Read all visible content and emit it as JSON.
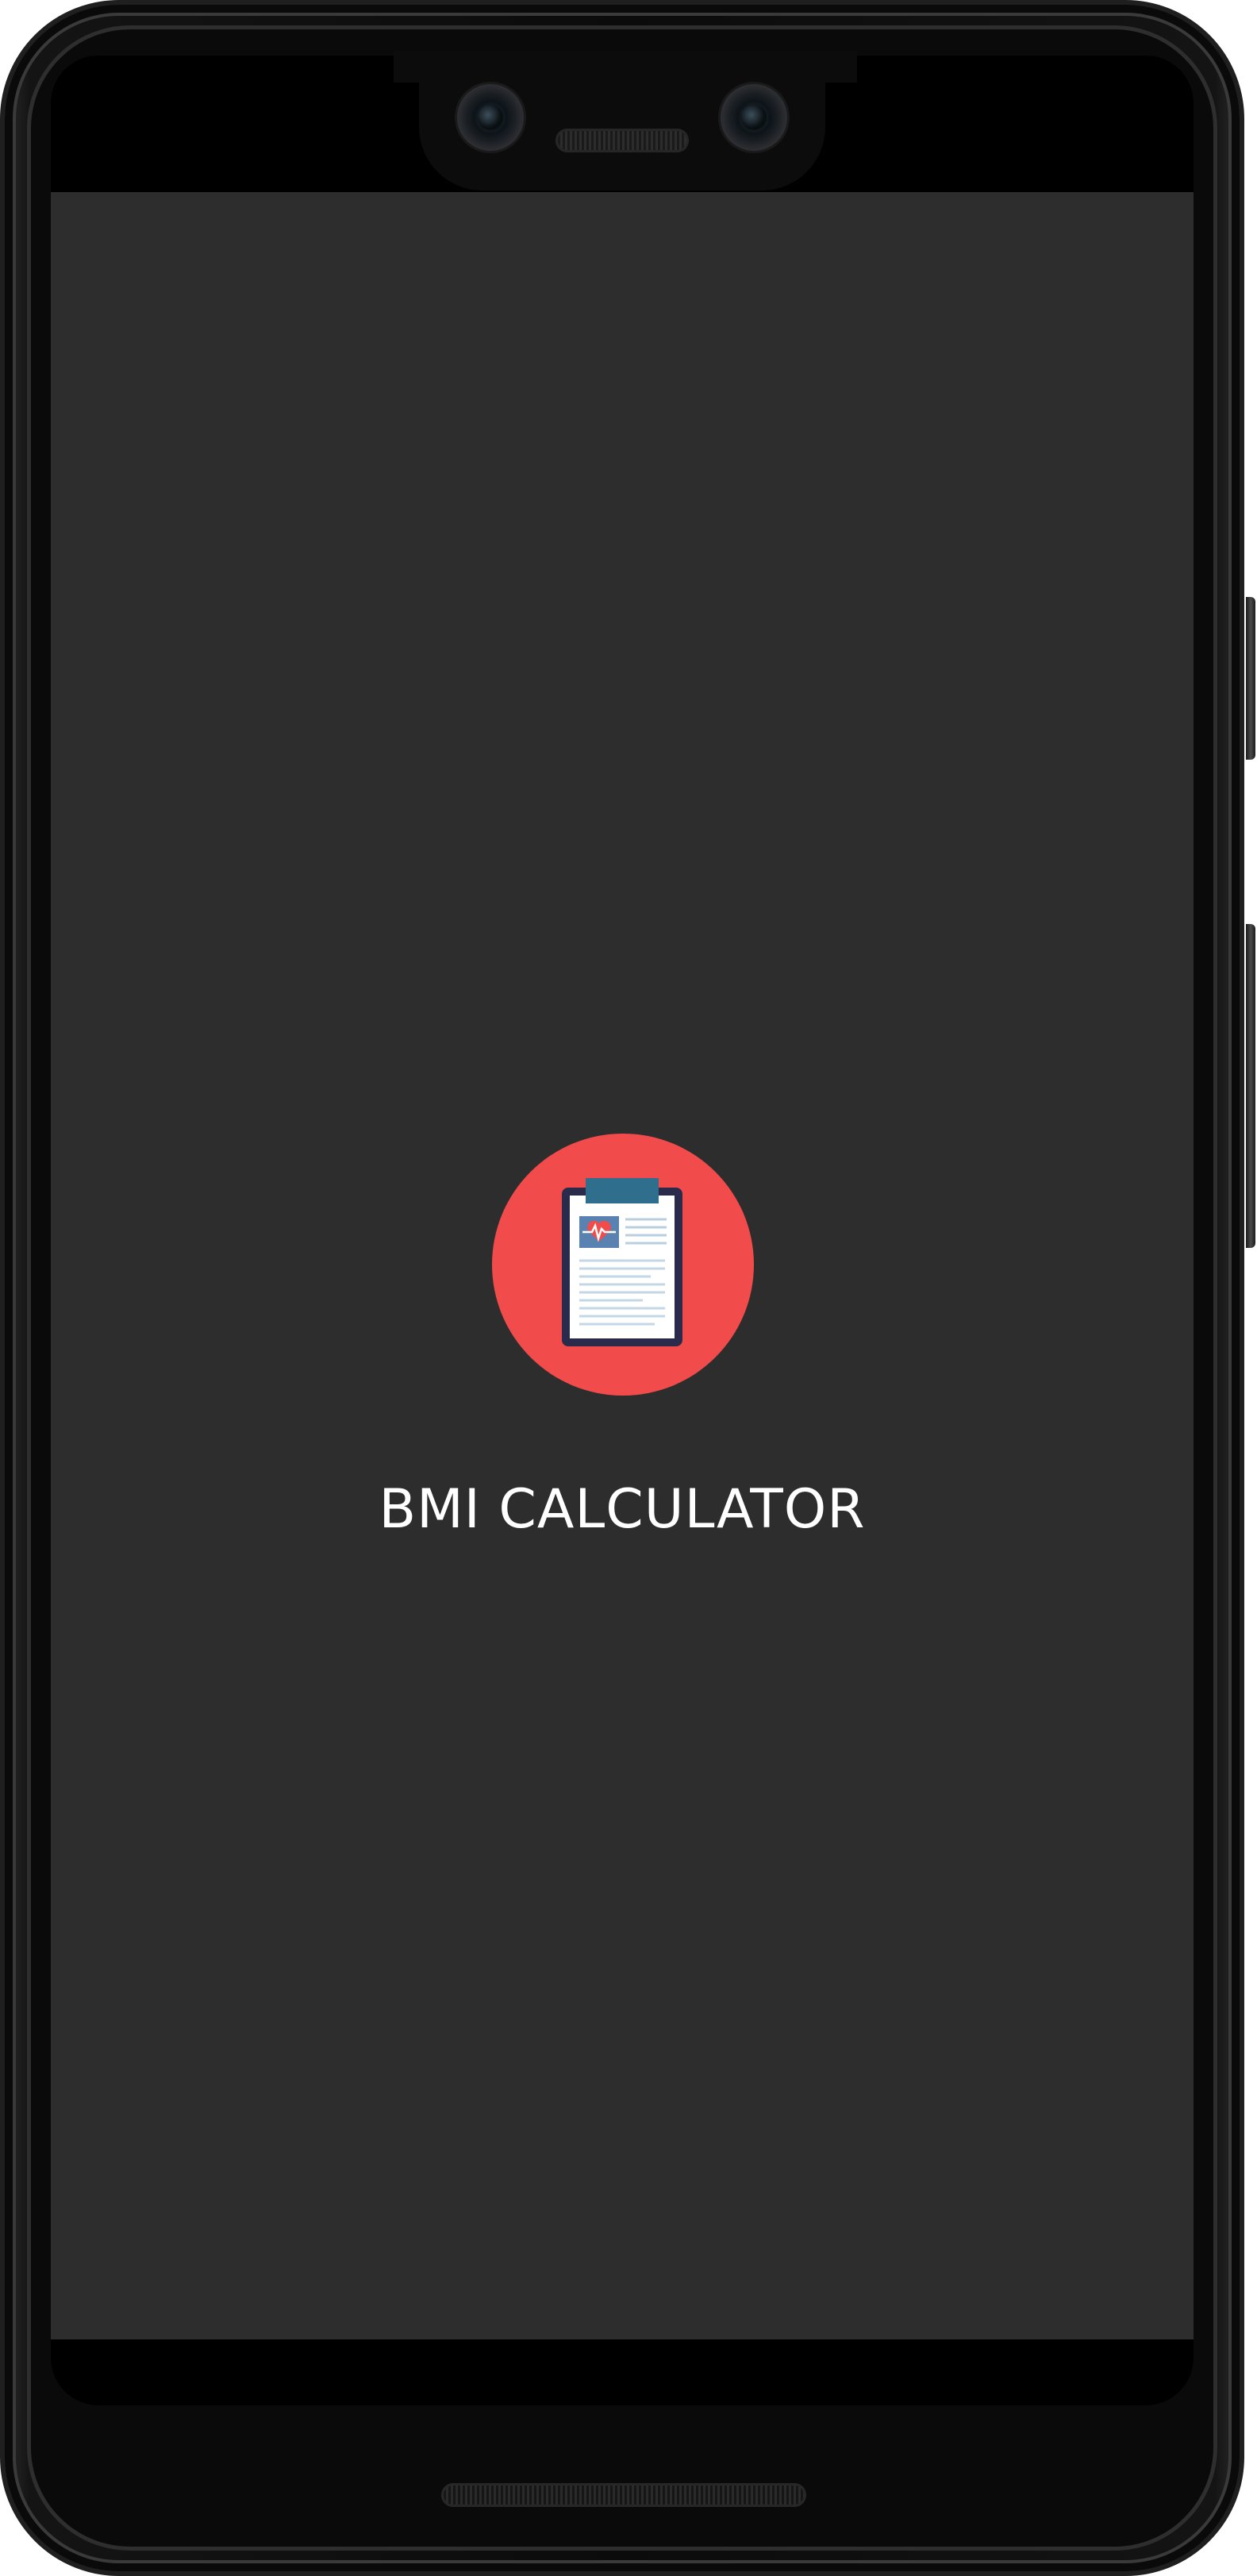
{
  "splash": {
    "app_title": "BMI CALCULATOR",
    "logo_icon": "medical-clipboard-icon"
  },
  "colors": {
    "screen_background": "#2d2d2d",
    "logo_circle": "#f24b4b",
    "clipboard_clip": "#2f6e8c",
    "clipboard_border": "#2a2a4a",
    "title_text": "#ffffff"
  }
}
